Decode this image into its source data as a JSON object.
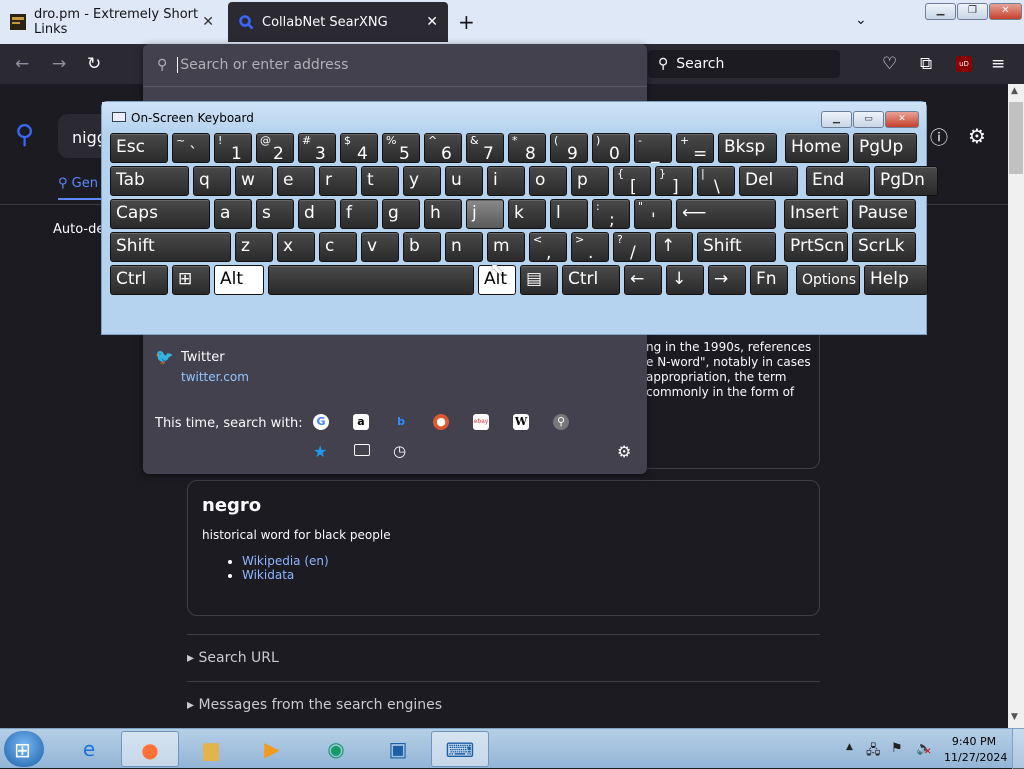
{
  "browser": {
    "tabs": [
      {
        "title": "dro.pm - Extremely Short Links",
        "active": false
      },
      {
        "title": "CollabNet SearXNG",
        "active": true
      }
    ],
    "new_tab_icon": "+",
    "list_tabs_icon": "chevron-down",
    "search_placeholder": "Search",
    "ublock_label": "uD"
  },
  "urlbar": {
    "placeholder": "Search or enter address",
    "suggestion": {
      "title": "Twitter",
      "url": "twitter.com"
    },
    "this_time_label": "This time, search with:",
    "engines": [
      "Google",
      "Amazon",
      "Bing",
      "DuckDuckGo",
      "eBay",
      "Wikipedia",
      "SearXNG"
    ]
  },
  "page": {
    "query": "nigg",
    "general_tab": "Gen",
    "autodetect": "Auto-det",
    "infobox1_text": "ng in the 1990s, references e N-word\", notably in cases appropriation, the term commonly in the form of",
    "infobox2": {
      "title": "negro",
      "description": "historical word for black people",
      "links": [
        "Wikipedia (en)",
        "Wikidata"
      ]
    },
    "search_url": "Search URL",
    "messages": "Messages from the search engines"
  },
  "osk": {
    "title": "On-Screen Keyboard",
    "rows": [
      [
        {
          "label": "Esc"
        },
        {
          "top": "~",
          "label": "`"
        },
        {
          "top": "!",
          "label": "1"
        },
        {
          "top": "@",
          "label": "2"
        },
        {
          "top": "#",
          "label": "3"
        },
        {
          "top": "$",
          "label": "4"
        },
        {
          "top": "%",
          "label": "5"
        },
        {
          "top": "^",
          "label": "6"
        },
        {
          "top": "&",
          "label": "7"
        },
        {
          "top": "*",
          "label": "8"
        },
        {
          "top": "(",
          "label": "9"
        },
        {
          "top": ")",
          "label": "0"
        },
        {
          "top": "-",
          "label": "_"
        },
        {
          "top": "+",
          "label": "="
        },
        {
          "label": "Bksp"
        },
        {
          "label": "Home"
        },
        {
          "label": "PgUp"
        }
      ],
      [
        {
          "label": "Tab"
        },
        {
          "label": "q"
        },
        {
          "label": "w"
        },
        {
          "label": "e"
        },
        {
          "label": "r"
        },
        {
          "label": "t"
        },
        {
          "label": "y"
        },
        {
          "label": "u"
        },
        {
          "label": "i"
        },
        {
          "label": "o"
        },
        {
          "label": "p"
        },
        {
          "top": "{",
          "label": "["
        },
        {
          "top": "}",
          "label": "]"
        },
        {
          "top": "|",
          "label": "\\"
        },
        {
          "label": "Del"
        },
        {
          "label": "End"
        },
        {
          "label": "PgDn"
        }
      ],
      [
        {
          "label": "Caps"
        },
        {
          "label": "a"
        },
        {
          "label": "s"
        },
        {
          "label": "d"
        },
        {
          "label": "f"
        },
        {
          "label": "g"
        },
        {
          "label": "h"
        },
        {
          "label": "j"
        },
        {
          "label": "k"
        },
        {
          "label": "l"
        },
        {
          "top": ":",
          "label": ";"
        },
        {
          "top": "\"",
          "label": "'"
        },
        {
          "label": "⟵"
        },
        {
          "label": "Insert"
        },
        {
          "label": "Pause"
        }
      ],
      [
        {
          "label": "Shift"
        },
        {
          "label": "z"
        },
        {
          "label": "x"
        },
        {
          "label": "c"
        },
        {
          "label": "v"
        },
        {
          "label": "b"
        },
        {
          "label": "n"
        },
        {
          "label": "m"
        },
        {
          "top": "<",
          "label": ","
        },
        {
          "top": ">",
          "label": "."
        },
        {
          "top": "?",
          "label": "/"
        },
        {
          "label": "↑"
        },
        {
          "label": "Shift"
        },
        {
          "label": "PrtScn"
        },
        {
          "label": "ScrLk"
        }
      ],
      [
        {
          "label": "Ctrl"
        },
        {
          "label": "⊞"
        },
        {
          "label": "Alt"
        },
        {
          "label": ""
        },
        {
          "label": "Alt"
        },
        {
          "label": "▤"
        },
        {
          "label": "Ctrl"
        },
        {
          "label": "←"
        },
        {
          "label": "↓"
        },
        {
          "label": "→"
        },
        {
          "label": "Fn"
        },
        {
          "label": "Options"
        },
        {
          "label": "Help"
        }
      ]
    ]
  },
  "taskbar": {
    "clock_time": "9:40 PM",
    "clock_date": "11/27/2024"
  },
  "colors": {
    "accent": "#3b67ff",
    "link": "#8fb5ff",
    "page_bg": "#1c1b22",
    "osk_frame": "#b5d3ee"
  }
}
